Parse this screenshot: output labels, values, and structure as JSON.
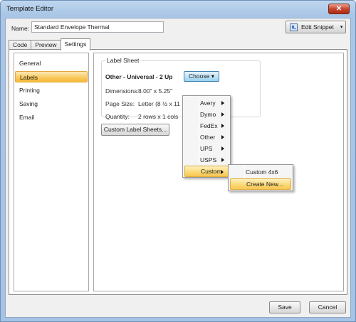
{
  "window": {
    "title": "Template Editor",
    "close_glyph": "✕"
  },
  "name_field": {
    "label": "Name:",
    "value": "Standard Envelope Thermal"
  },
  "snippet_button": {
    "label": "Edit Snippet",
    "icon": "snippet-icon",
    "arrow": "▾"
  },
  "tabs": [
    {
      "label": "Code",
      "active": false
    },
    {
      "label": "Preview",
      "active": false
    },
    {
      "label": "Settings",
      "active": true
    }
  ],
  "sidebar": {
    "items": [
      {
        "label": "General",
        "active": false
      },
      {
        "label": "Labels",
        "active": true
      },
      {
        "label": "Printing",
        "active": false
      },
      {
        "label": "Saving",
        "active": false
      },
      {
        "label": "Email",
        "active": false
      }
    ]
  },
  "label_sheet": {
    "legend": "Label Sheet",
    "name": "Other - Universal - 2 Up",
    "choose_label": "Choose",
    "choose_arrow": "▾",
    "dimensions_label": "Dimensions:",
    "dimensions_value": "8.00\" x 5.25\"",
    "page_size_label": "Page Size:",
    "page_size_value": "Letter (8 ½ x 11",
    "quantity_label": "Quantity:",
    "quantity_value": "2 rows x 1 cols",
    "custom_sheets_button": "Custom Label Sheets..."
  },
  "choose_menu": {
    "items": [
      {
        "label": "Avery",
        "submenu": true,
        "highlighted": false
      },
      {
        "label": "Dymo",
        "submenu": true,
        "highlighted": false
      },
      {
        "label": "FedEx",
        "submenu": true,
        "highlighted": false
      },
      {
        "label": "Other",
        "submenu": true,
        "highlighted": false
      },
      {
        "label": "UPS",
        "submenu": true,
        "highlighted": false
      },
      {
        "label": "USPS",
        "submenu": true,
        "highlighted": false
      },
      {
        "label": "Custom",
        "submenu": true,
        "highlighted": true
      }
    ]
  },
  "custom_submenu": {
    "items": [
      {
        "label": "Custom 4x6",
        "highlighted": false
      },
      {
        "label": "Create New...",
        "highlighted": true
      }
    ]
  },
  "footer": {
    "save_label": "Save",
    "cancel_label": "Cancel"
  },
  "colors": {
    "highlight": "#f9c85a",
    "choose_button": "#c4e5f6",
    "title_bar": "#bfd6ef",
    "close_button": "#c8452e"
  }
}
